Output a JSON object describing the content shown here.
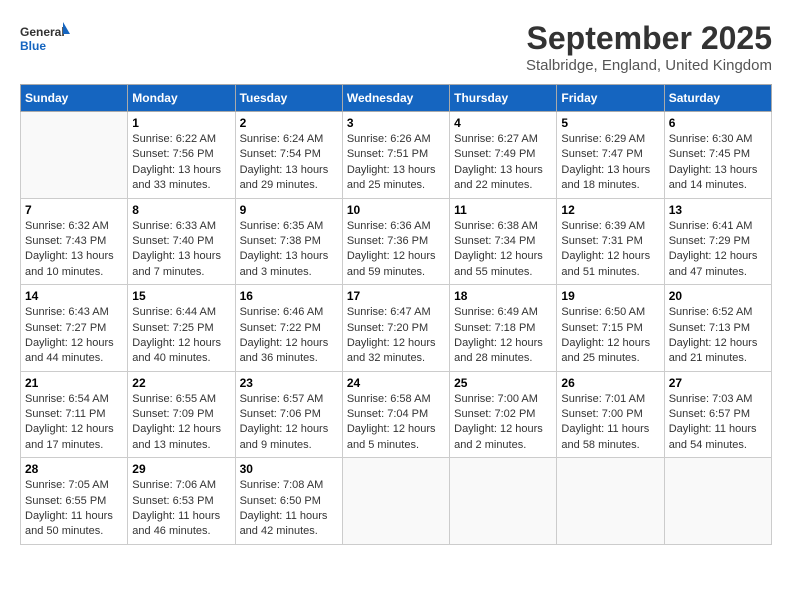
{
  "header": {
    "logo_general": "General",
    "logo_blue": "Blue",
    "month": "September 2025",
    "location": "Stalbridge, England, United Kingdom"
  },
  "weekdays": [
    "Sunday",
    "Monday",
    "Tuesday",
    "Wednesday",
    "Thursday",
    "Friday",
    "Saturday"
  ],
  "weeks": [
    [
      {
        "day": "",
        "sunrise": "",
        "sunset": "",
        "daylight": ""
      },
      {
        "day": "1",
        "sunrise": "Sunrise: 6:22 AM",
        "sunset": "Sunset: 7:56 PM",
        "daylight": "Daylight: 13 hours and 33 minutes."
      },
      {
        "day": "2",
        "sunrise": "Sunrise: 6:24 AM",
        "sunset": "Sunset: 7:54 PM",
        "daylight": "Daylight: 13 hours and 29 minutes."
      },
      {
        "day": "3",
        "sunrise": "Sunrise: 6:26 AM",
        "sunset": "Sunset: 7:51 PM",
        "daylight": "Daylight: 13 hours and 25 minutes."
      },
      {
        "day": "4",
        "sunrise": "Sunrise: 6:27 AM",
        "sunset": "Sunset: 7:49 PM",
        "daylight": "Daylight: 13 hours and 22 minutes."
      },
      {
        "day": "5",
        "sunrise": "Sunrise: 6:29 AM",
        "sunset": "Sunset: 7:47 PM",
        "daylight": "Daylight: 13 hours and 18 minutes."
      },
      {
        "day": "6",
        "sunrise": "Sunrise: 6:30 AM",
        "sunset": "Sunset: 7:45 PM",
        "daylight": "Daylight: 13 hours and 14 minutes."
      }
    ],
    [
      {
        "day": "7",
        "sunrise": "Sunrise: 6:32 AM",
        "sunset": "Sunset: 7:43 PM",
        "daylight": "Daylight: 13 hours and 10 minutes."
      },
      {
        "day": "8",
        "sunrise": "Sunrise: 6:33 AM",
        "sunset": "Sunset: 7:40 PM",
        "daylight": "Daylight: 13 hours and 7 minutes."
      },
      {
        "day": "9",
        "sunrise": "Sunrise: 6:35 AM",
        "sunset": "Sunset: 7:38 PM",
        "daylight": "Daylight: 13 hours and 3 minutes."
      },
      {
        "day": "10",
        "sunrise": "Sunrise: 6:36 AM",
        "sunset": "Sunset: 7:36 PM",
        "daylight": "Daylight: 12 hours and 59 minutes."
      },
      {
        "day": "11",
        "sunrise": "Sunrise: 6:38 AM",
        "sunset": "Sunset: 7:34 PM",
        "daylight": "Daylight: 12 hours and 55 minutes."
      },
      {
        "day": "12",
        "sunrise": "Sunrise: 6:39 AM",
        "sunset": "Sunset: 7:31 PM",
        "daylight": "Daylight: 12 hours and 51 minutes."
      },
      {
        "day": "13",
        "sunrise": "Sunrise: 6:41 AM",
        "sunset": "Sunset: 7:29 PM",
        "daylight": "Daylight: 12 hours and 47 minutes."
      }
    ],
    [
      {
        "day": "14",
        "sunrise": "Sunrise: 6:43 AM",
        "sunset": "Sunset: 7:27 PM",
        "daylight": "Daylight: 12 hours and 44 minutes."
      },
      {
        "day": "15",
        "sunrise": "Sunrise: 6:44 AM",
        "sunset": "Sunset: 7:25 PM",
        "daylight": "Daylight: 12 hours and 40 minutes."
      },
      {
        "day": "16",
        "sunrise": "Sunrise: 6:46 AM",
        "sunset": "Sunset: 7:22 PM",
        "daylight": "Daylight: 12 hours and 36 minutes."
      },
      {
        "day": "17",
        "sunrise": "Sunrise: 6:47 AM",
        "sunset": "Sunset: 7:20 PM",
        "daylight": "Daylight: 12 hours and 32 minutes."
      },
      {
        "day": "18",
        "sunrise": "Sunrise: 6:49 AM",
        "sunset": "Sunset: 7:18 PM",
        "daylight": "Daylight: 12 hours and 28 minutes."
      },
      {
        "day": "19",
        "sunrise": "Sunrise: 6:50 AM",
        "sunset": "Sunset: 7:15 PM",
        "daylight": "Daylight: 12 hours and 25 minutes."
      },
      {
        "day": "20",
        "sunrise": "Sunrise: 6:52 AM",
        "sunset": "Sunset: 7:13 PM",
        "daylight": "Daylight: 12 hours and 21 minutes."
      }
    ],
    [
      {
        "day": "21",
        "sunrise": "Sunrise: 6:54 AM",
        "sunset": "Sunset: 7:11 PM",
        "daylight": "Daylight: 12 hours and 17 minutes."
      },
      {
        "day": "22",
        "sunrise": "Sunrise: 6:55 AM",
        "sunset": "Sunset: 7:09 PM",
        "daylight": "Daylight: 12 hours and 13 minutes."
      },
      {
        "day": "23",
        "sunrise": "Sunrise: 6:57 AM",
        "sunset": "Sunset: 7:06 PM",
        "daylight": "Daylight: 12 hours and 9 minutes."
      },
      {
        "day": "24",
        "sunrise": "Sunrise: 6:58 AM",
        "sunset": "Sunset: 7:04 PM",
        "daylight": "Daylight: 12 hours and 5 minutes."
      },
      {
        "day": "25",
        "sunrise": "Sunrise: 7:00 AM",
        "sunset": "Sunset: 7:02 PM",
        "daylight": "Daylight: 12 hours and 2 minutes."
      },
      {
        "day": "26",
        "sunrise": "Sunrise: 7:01 AM",
        "sunset": "Sunset: 7:00 PM",
        "daylight": "Daylight: 11 hours and 58 minutes."
      },
      {
        "day": "27",
        "sunrise": "Sunrise: 7:03 AM",
        "sunset": "Sunset: 6:57 PM",
        "daylight": "Daylight: 11 hours and 54 minutes."
      }
    ],
    [
      {
        "day": "28",
        "sunrise": "Sunrise: 7:05 AM",
        "sunset": "Sunset: 6:55 PM",
        "daylight": "Daylight: 11 hours and 50 minutes."
      },
      {
        "day": "29",
        "sunrise": "Sunrise: 7:06 AM",
        "sunset": "Sunset: 6:53 PM",
        "daylight": "Daylight: 11 hours and 46 minutes."
      },
      {
        "day": "30",
        "sunrise": "Sunrise: 7:08 AM",
        "sunset": "Sunset: 6:50 PM",
        "daylight": "Daylight: 11 hours and 42 minutes."
      },
      {
        "day": "",
        "sunrise": "",
        "sunset": "",
        "daylight": ""
      },
      {
        "day": "",
        "sunrise": "",
        "sunset": "",
        "daylight": ""
      },
      {
        "day": "",
        "sunrise": "",
        "sunset": "",
        "daylight": ""
      },
      {
        "day": "",
        "sunrise": "",
        "sunset": "",
        "daylight": ""
      }
    ]
  ]
}
